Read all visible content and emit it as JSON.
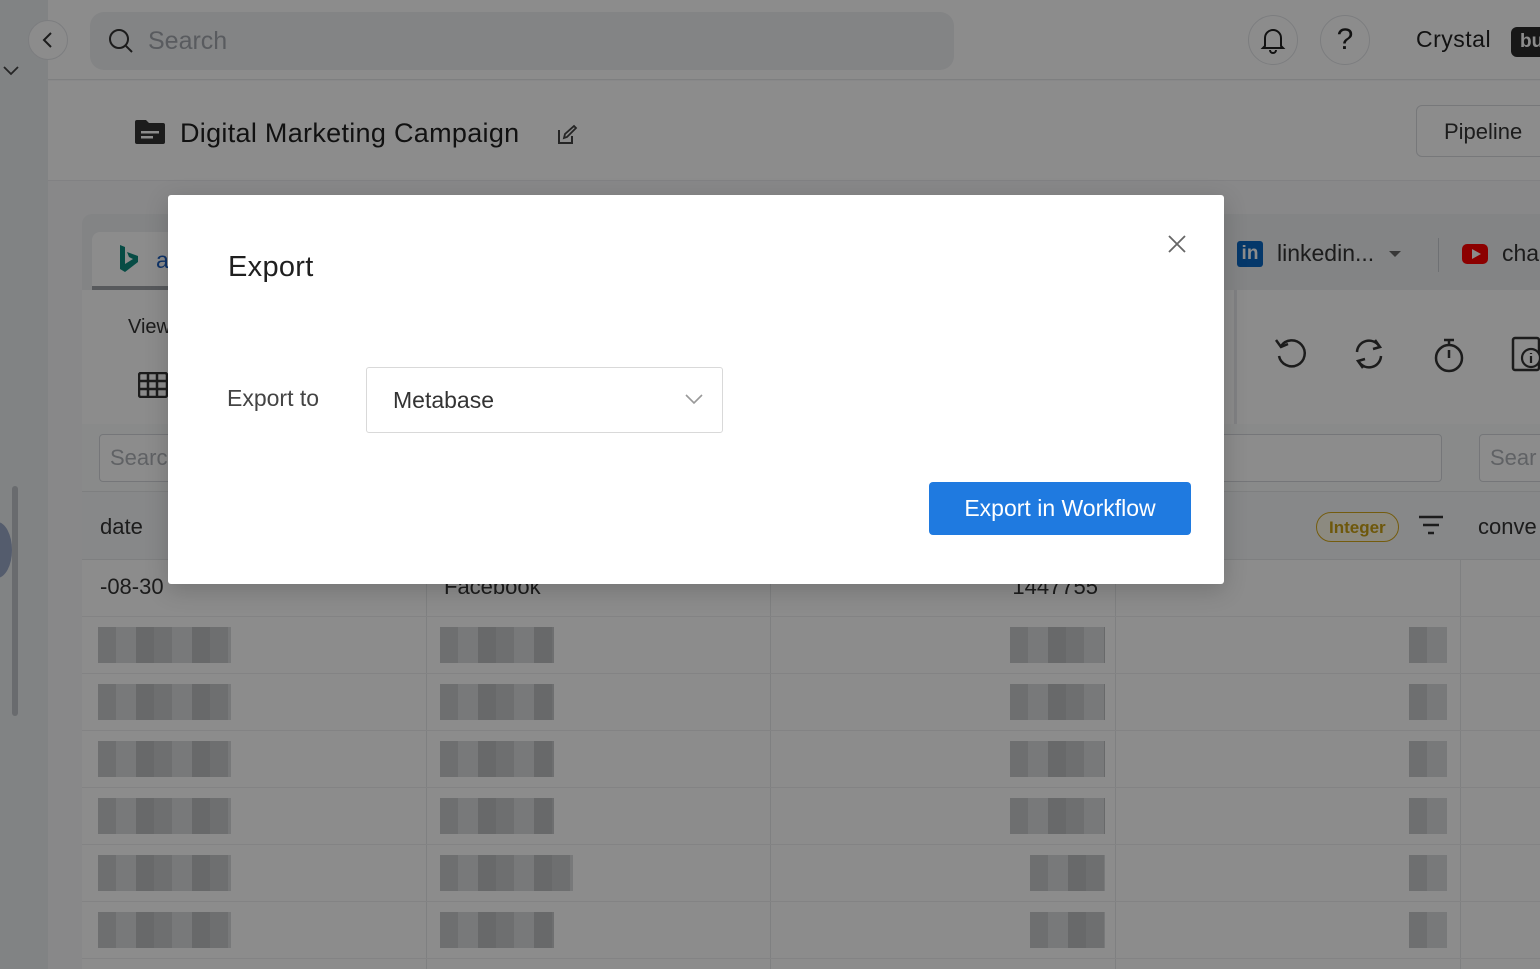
{
  "topbar": {
    "search_placeholder": "Search",
    "bell_icon": "bell-icon",
    "help_label": "?",
    "user_name": "Crystal",
    "user_badge": "bu"
  },
  "page": {
    "title": "Digital Marketing Campaign",
    "pipeline_button": "Pipeline"
  },
  "tabs": {
    "bing_label": "a",
    "linkedin_label": "linkedin...",
    "youtube_label": "cha"
  },
  "toolbar": {
    "view_label": "View"
  },
  "table": {
    "filter_placeholder_1": "Search",
    "filter_placeholder_2": "Sear",
    "columns": [
      "date",
      "conve"
    ],
    "type_badge": "Integer",
    "first_row": {
      "date": "-08-30",
      "channel": "Facebook",
      "value": "1447755"
    }
  },
  "modal": {
    "title": "Export",
    "export_to_label": "Export to",
    "export_to_value": "Metabase",
    "submit_button": "Export in Workflow"
  },
  "colors": {
    "primary": "#1f7ae0",
    "overlay": "rgba(0,0,0,0.45)",
    "badge": "#c9a015"
  }
}
